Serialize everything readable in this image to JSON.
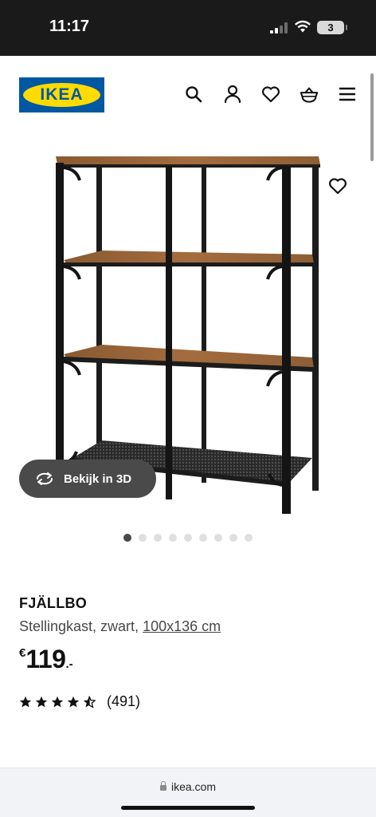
{
  "status_bar": {
    "time": "11:17",
    "battery": "3",
    "icons": [
      "signal-icon",
      "wifi-icon",
      "battery-icon"
    ]
  },
  "header": {
    "logo_text": "IKEA",
    "icons": [
      "search-icon",
      "account-icon",
      "heart-icon",
      "basket-icon",
      "menu-icon"
    ],
    "brand_colors": {
      "blue": "#0058a3",
      "yellow": "#ffdb00"
    }
  },
  "gallery": {
    "view_3d_label": "Bekijk in 3D",
    "slide_count": 9,
    "active_slide": 1
  },
  "product": {
    "name": "FJÄLLBO",
    "description": "Stellingkast, zwart, ",
    "size": "100x136 cm",
    "price_currency": "€",
    "price_amount": "119",
    "price_decimals": ".-",
    "rating": 4.5,
    "rating_max": 5,
    "review_count": "(491)"
  },
  "browser": {
    "url": "ikea.com"
  }
}
